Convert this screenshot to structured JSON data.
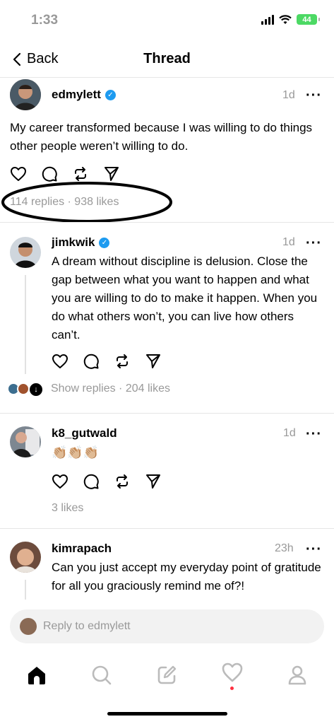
{
  "status": {
    "time": "1:33",
    "battery": "44"
  },
  "nav": {
    "back_label": "Back",
    "title": "Thread"
  },
  "original_post": {
    "username": "edmylett",
    "time": "1d",
    "text": "My career transformed because I was willing to do things other people weren’t willing to do.",
    "meta": "114 replies · 938 likes"
  },
  "replies": [
    {
      "username": "jimkwik",
      "time": "1d",
      "text": "A dream without discipline is delusion. Close the gap between what you want to happen and what you are willing to do to make it happen. When you do what others won’t, you can live how others can’t.",
      "meta": "Show replies · 204 likes"
    },
    {
      "username": "k8_gutwald",
      "time": "1d",
      "text": "👏🏼👏🏼👏🏼",
      "meta": "3 likes"
    },
    {
      "username": "kimrapach",
      "time": "23h",
      "text": "Can you just accept my everyday point of gratitude for all you graciously remind me of?!"
    }
  ],
  "reply_input": {
    "placeholder": "Reply to edmylett"
  },
  "colors": {
    "verified": "#1d9bf0",
    "battery": "#4cd964",
    "notification_dot": "#ff3040"
  }
}
